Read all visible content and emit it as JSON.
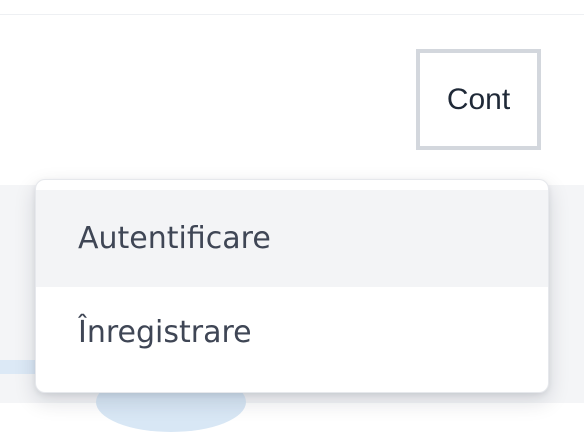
{
  "header": {
    "account_label": "Cont"
  },
  "menu": {
    "items": [
      {
        "label": "Autentificare"
      },
      {
        "label": "Înregistrare"
      }
    ]
  },
  "colors": {
    "background": "#ffffff",
    "menu_hover": "#f3f4f6",
    "button_border": "#d3d7dd",
    "text": "#3f4655"
  }
}
